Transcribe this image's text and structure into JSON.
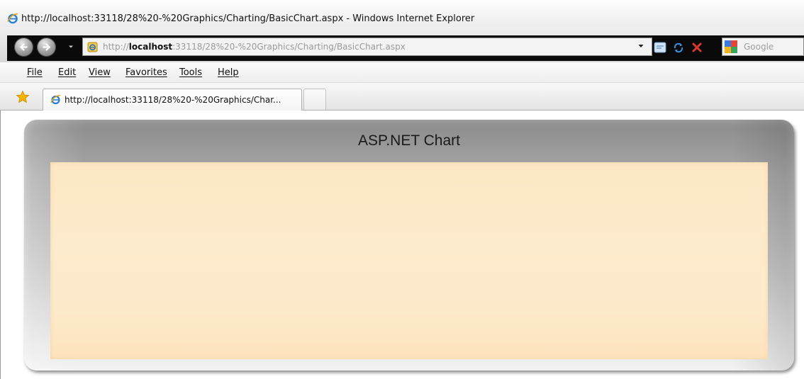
{
  "window": {
    "title": "http://localhost:33118/28%20-%20Graphics/Charting/BasicChart.aspx - Windows Internet Explorer",
    "title_icon": "ie-logo-icon"
  },
  "navigation": {
    "back_icon": "back-arrow-icon",
    "forward_icon": "forward-arrow-icon",
    "address": {
      "prefix": "http://",
      "host": "localhost",
      "path": ":33118/28%20-%20Graphics/Charting/BasicChart.aspx"
    },
    "search_placeholder": "Google"
  },
  "menu": {
    "items": [
      "File",
      "Edit",
      "View",
      "Favorites",
      "Tools",
      "Help"
    ]
  },
  "tabs": {
    "active_label": "http://localhost:33118/28%20-%20Graphics/Char..."
  },
  "page": {
    "chart_title": "ASP.NET Chart"
  },
  "colors": {
    "plot_background": "#fde9c8",
    "frame_dark": "#8a8a8a",
    "frame_light": "#f2f2f2",
    "nav_black": "#0a0a0a"
  }
}
